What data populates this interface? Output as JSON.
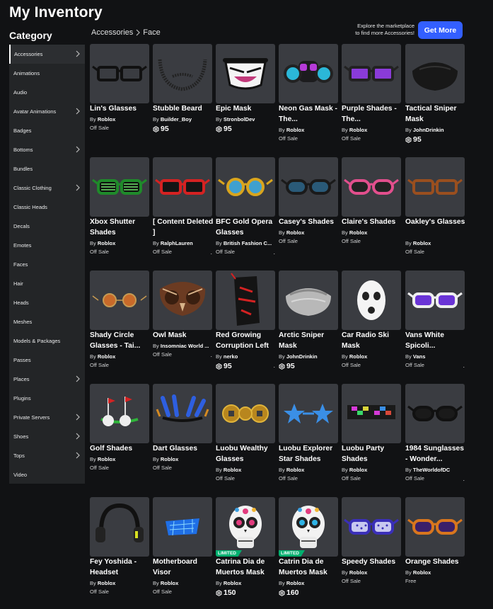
{
  "page_title": "My Inventory",
  "category_heading": "Category",
  "sidebar": {
    "items": [
      {
        "label": "Accessories",
        "chevron": true,
        "active": true
      },
      {
        "label": "Animations",
        "chevron": false
      },
      {
        "label": "Audio",
        "chevron": false
      },
      {
        "label": "Avatar Animations",
        "chevron": true
      },
      {
        "label": "Badges",
        "chevron": false
      },
      {
        "label": "Bottoms",
        "chevron": true
      },
      {
        "label": "Bundles",
        "chevron": false
      },
      {
        "label": "Classic Clothing",
        "chevron": true
      },
      {
        "label": "Classic Heads",
        "chevron": false
      },
      {
        "label": "Decals",
        "chevron": false
      },
      {
        "label": "Emotes",
        "chevron": false
      },
      {
        "label": "Faces",
        "chevron": false
      },
      {
        "label": "Hair",
        "chevron": false
      },
      {
        "label": "Heads",
        "chevron": false
      },
      {
        "label": "Meshes",
        "chevron": false
      },
      {
        "label": "Models & Packages",
        "chevron": false
      },
      {
        "label": "Passes",
        "chevron": false
      },
      {
        "label": "Places",
        "chevron": true
      },
      {
        "label": "Plugins",
        "chevron": false
      },
      {
        "label": "Private Servers",
        "chevron": true
      },
      {
        "label": "Shoes",
        "chevron": true
      },
      {
        "label": "Tops",
        "chevron": true
      },
      {
        "label": "Video",
        "chevron": false
      }
    ]
  },
  "breadcrumb": {
    "parent": "Accessories",
    "current": "Face"
  },
  "promo": {
    "line1": "Explore the marketplace",
    "line2": "to find more Accessories!",
    "button": "Get More"
  },
  "colors": {
    "accent": "#335fff",
    "limited": "#00b06f",
    "card_bg": "#3a3c41",
    "sidebar_bg": "#232527"
  },
  "items": [
    {
      "name": "Lin's Glasses",
      "by": "By",
      "creator": "Roblox",
      "price": "Off Sale",
      "robux": false,
      "icon": "black-glasses"
    },
    {
      "name": "Stubble Beard",
      "by": "By",
      "creator": "Builder_Boy",
      "price": "95",
      "robux": true,
      "icon": "stubble-beard"
    },
    {
      "name": "Epic Mask",
      "by": "By",
      "creator": "StronbolDev",
      "price": "95",
      "robux": true,
      "icon": "epic-mask"
    },
    {
      "name": "Neon Gas Mask - The...",
      "by": "By",
      "creator": "Roblox",
      "price": "Off Sale",
      "robux": false,
      "icon": "gas-mask"
    },
    {
      "name": "Purple Shades - The...",
      "by": "By",
      "creator": "Roblox",
      "price": "Off Sale",
      "robux": false,
      "icon": "purple-shades"
    },
    {
      "name": "Tactical Sniper Mask",
      "by": "By",
      "creator": "JohnDrinkin",
      "price": "95",
      "robux": true,
      "icon": "sniper-mask"
    },
    {
      "name": "Xbox Shutter Shades",
      "by": "By",
      "creator": "Roblox",
      "price": "Off Sale",
      "robux": false,
      "icon": "xbox-shades"
    },
    {
      "name": "[ Content Deleted ]",
      "by": "By",
      "creator": "RalphLauren",
      "price": "Off Sale",
      "robux": false,
      "icon": "red-glasses",
      "dots": true
    },
    {
      "name": "BFC Gold Opera Glasses",
      "by": "By",
      "creator": "British Fashion C...",
      "price": "Off Sale",
      "robux": false,
      "icon": "gold-glasses",
      "dots": true
    },
    {
      "name": "Casey's Shades",
      "by": "By",
      "creator": "Roblox",
      "price": "Off Sale",
      "robux": false,
      "icon": "casey-shades"
    },
    {
      "name": "Claire's Shades",
      "by": "By",
      "creator": "Roblox",
      "price": "Off Sale",
      "robux": false,
      "icon": "pink-shades"
    },
    {
      "name": "Oakley's Glasses",
      "by": "By",
      "creator": "Roblox",
      "price": "Off Sale",
      "robux": false,
      "icon": "brown-glasses"
    },
    {
      "name": "Shady Circle Glasses - Tai...",
      "by": "By",
      "creator": "Roblox",
      "price": "Off Sale",
      "robux": false,
      "icon": "circle-glasses"
    },
    {
      "name": "Owl Mask",
      "by": "By",
      "creator": "Insomniac World ...",
      "price": "Off Sale",
      "robux": false,
      "icon": "owl-mask",
      "dots": true
    },
    {
      "name": "Red Growing Corruption Left",
      "by": "By",
      "creator": "nerko",
      "price": "95",
      "robux": true,
      "icon": "corruption",
      "dots": true
    },
    {
      "name": "Arctic Sniper Mask",
      "by": "By",
      "creator": "JohnDrinkin",
      "price": "95",
      "robux": true,
      "icon": "arctic-mask"
    },
    {
      "name": "Car Radio Ski Mask",
      "by": "By",
      "creator": "Roblox",
      "price": "Off Sale",
      "robux": false,
      "icon": "ski-mask"
    },
    {
      "name": "Vans White Spicoli...",
      "by": "By",
      "creator": "Vans",
      "price": "Off Sale",
      "robux": false,
      "icon": "vans-shades",
      "dots": true
    },
    {
      "name": "Golf Shades",
      "by": "By",
      "creator": "Roblox",
      "price": "Off Sale",
      "robux": false,
      "icon": "golf-shades"
    },
    {
      "name": "Dart Glasses",
      "by": "By",
      "creator": "Roblox",
      "price": "Off Sale",
      "robux": false,
      "icon": "dart-glasses"
    },
    {
      "name": "Luobu Wealthy Glasses",
      "by": "By",
      "creator": "Roblox",
      "price": "Off Sale",
      "robux": false,
      "icon": "coin-glasses"
    },
    {
      "name": "Luobu Explorer Star Shades",
      "by": "By",
      "creator": "Roblox",
      "price": "Off Sale",
      "robux": false,
      "icon": "star-shades"
    },
    {
      "name": "Luobu Party Shades",
      "by": "By",
      "creator": "Roblox",
      "price": "Off Sale",
      "robux": false,
      "icon": "party-shades"
    },
    {
      "name": "1984 Sunglasses - Wonder...",
      "by": "By",
      "creator": "TheWorldofDC",
      "price": "Off Sale",
      "robux": false,
      "icon": "sunglasses-1984",
      "dots": true
    },
    {
      "name": "Fey Yoshida - Headset",
      "by": "By",
      "creator": "Roblox",
      "price": "Off Sale",
      "robux": false,
      "icon": "headset"
    },
    {
      "name": "Motherboard Visor",
      "by": "By",
      "creator": "Roblox",
      "price": "Off Sale",
      "robux": false,
      "icon": "visor"
    },
    {
      "name": "Catrina Dia de Muertos Mask",
      "by": "By",
      "creator": "Roblox",
      "price": "150",
      "robux": true,
      "icon": "catrina-skull",
      "limited": "LIMITED"
    },
    {
      "name": "Catrin Dia de Muertos Mask",
      "by": "By",
      "creator": "Roblox",
      "price": "160",
      "robux": true,
      "icon": "catrin-skull",
      "limited": "LIMITED"
    },
    {
      "name": "Speedy Shades",
      "by": "By",
      "creator": "Roblox",
      "price": "Off Sale",
      "robux": false,
      "icon": "speedy-shades"
    },
    {
      "name": "Orange Shades",
      "by": "By",
      "creator": "Roblox",
      "price": "Free",
      "robux": false,
      "icon": "orange-shades"
    }
  ]
}
